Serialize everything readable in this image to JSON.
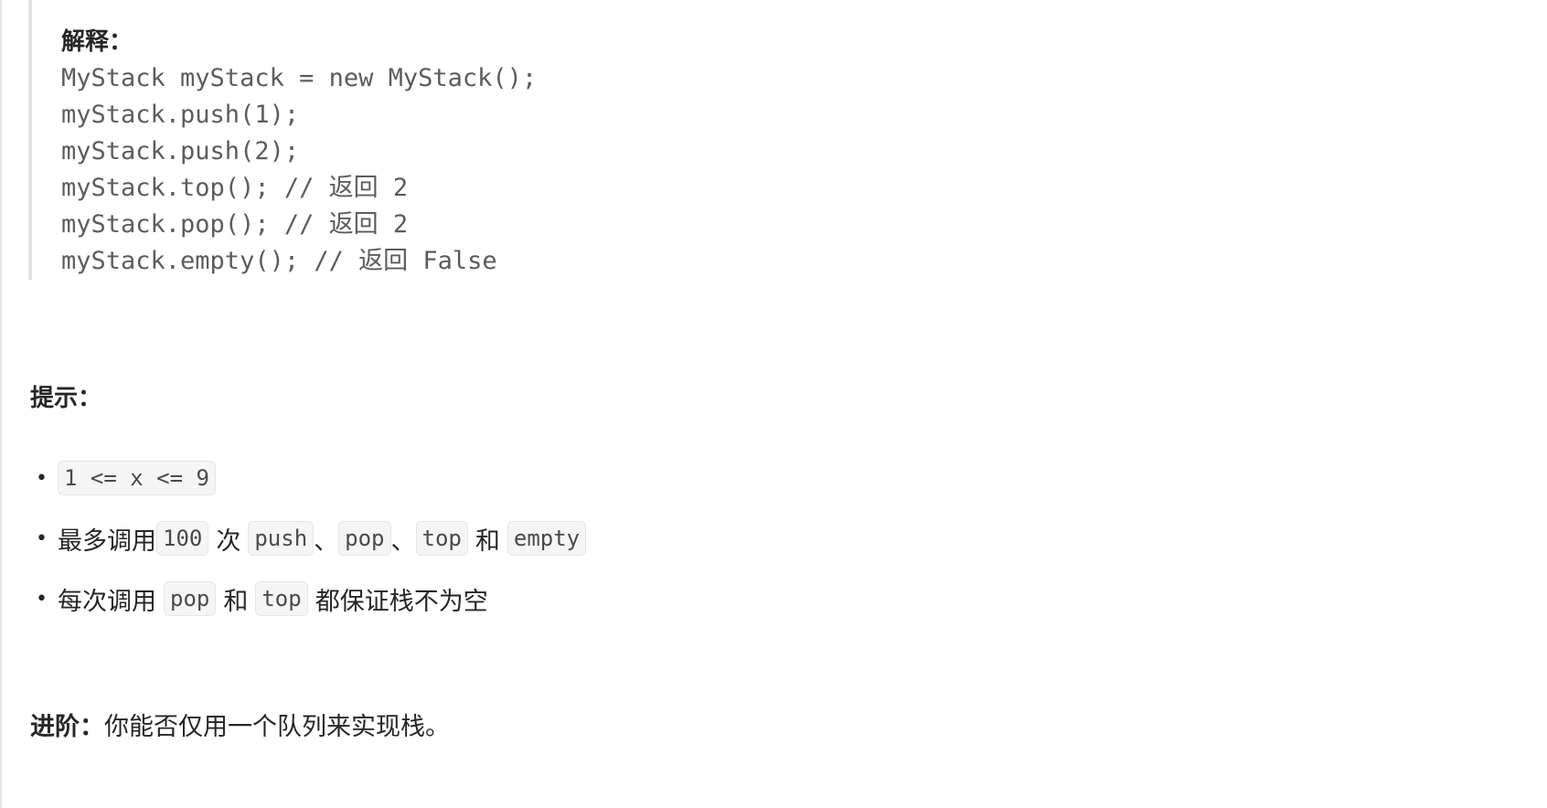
{
  "explanation": {
    "title": "解释：",
    "lines": [
      "MyStack myStack = new MyStack();",
      "myStack.push(1);",
      "myStack.push(2);",
      "myStack.top(); // 返回 2",
      "myStack.pop(); // 返回 2",
      "myStack.empty(); // 返回 False"
    ]
  },
  "hints": {
    "title": "提示：",
    "bullet": "•",
    "item1": {
      "code": "1 <= x <= 9"
    },
    "item2": {
      "text1": "最多调用",
      "code1": "100",
      "text2": "次",
      "code2": "push",
      "sep1": "、",
      "code3": "pop",
      "sep2": "、",
      "code4": "top",
      "text3": "和",
      "code5": "empty"
    },
    "item3": {
      "text1": "每次调用",
      "code1": "pop",
      "text2": "和",
      "code2": "top",
      "text3": "都保证栈不为空"
    }
  },
  "advanced": {
    "label": "进阶：",
    "text": "你能否仅用一个队列来实现栈。"
  }
}
